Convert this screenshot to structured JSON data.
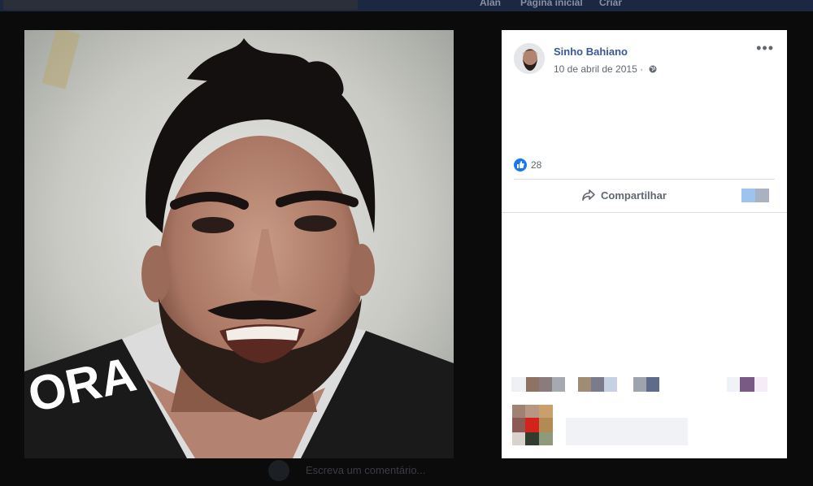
{
  "header": {
    "nav_user": "Alan",
    "nav_home": "Página inicial",
    "nav_create": "Criar"
  },
  "post": {
    "author": "Sinho Bahiano",
    "date": "10 de abril de 2015",
    "date_sep": "·",
    "privacy_icon": "globe-icon",
    "more_label": "•••",
    "likes_count": "28",
    "share_label": "Compartilhar"
  },
  "background": {
    "comment_placeholder": "Escreva um comentário..."
  },
  "colors": {
    "link": "#385898",
    "like_blue": "#1877f2",
    "muted": "#606770"
  }
}
